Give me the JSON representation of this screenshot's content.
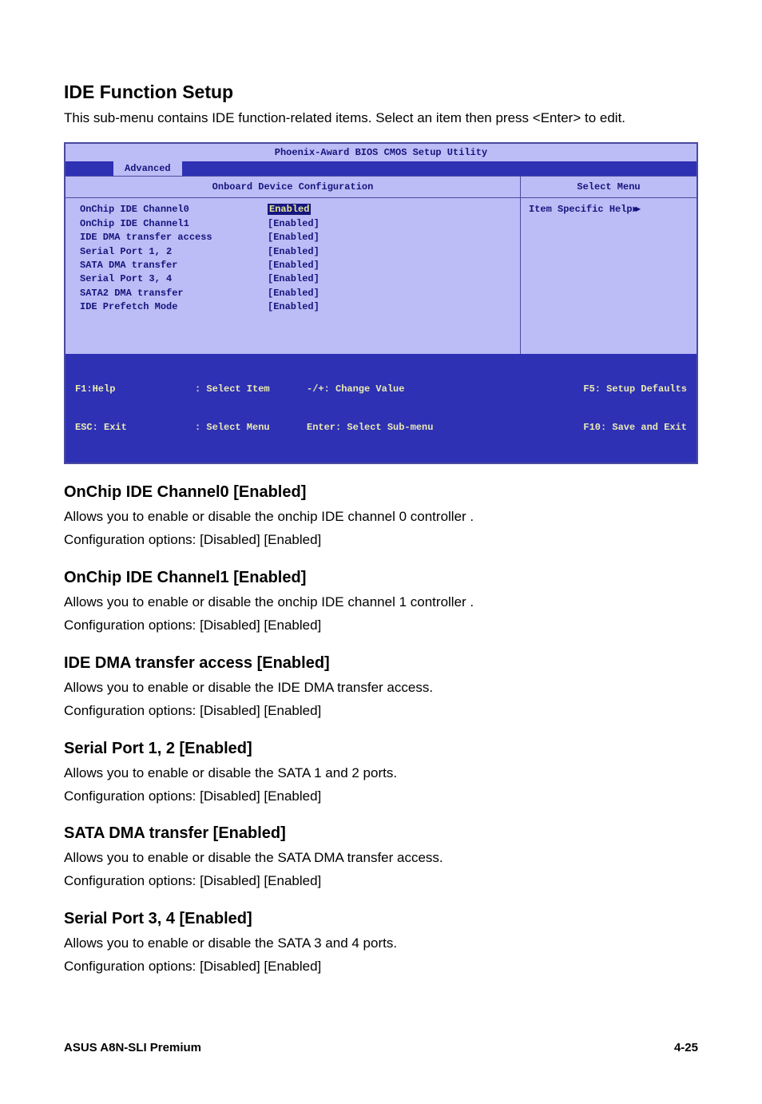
{
  "intro": {
    "heading": "IDE Function Setup",
    "text": "This sub-menu contains IDE function-related items. Select an item then press <Enter> to edit."
  },
  "bios": {
    "title": "Phoenix-Award BIOS CMOS Setup Utility",
    "tab": "Advanced",
    "panel_title": "Onboard Device Configuration",
    "select_menu": "Select Menu",
    "help_label": "Item Specific Help",
    "items": [
      {
        "label": "OnChip IDE Channel0",
        "value": "Enabled"
      },
      {
        "label": "OnChip IDE Channel1",
        "value": "[Enabled]"
      },
      {
        "label": "IDE DMA transfer access",
        "value": "[Enabled]"
      },
      {
        "label": "Serial Port 1, 2",
        "value": "[Enabled]"
      },
      {
        "label": "SATA DMA transfer",
        "value": "[Enabled]"
      },
      {
        "label": "Serial Port 3, 4",
        "value": "[Enabled]"
      },
      {
        "label": "SATA2 DMA transfer",
        "value": "[Enabled]"
      },
      {
        "label": "IDE Prefetch Mode",
        "value": "[Enabled]"
      }
    ],
    "footer": {
      "f1": "F1:Help",
      "esc": "ESC: Exit",
      "sel_item": ": Select Item",
      "sel_menu": ": Select Menu",
      "change": "-/+: Change Value",
      "enter": "Enter: Select Sub-menu",
      "f5": "F5: Setup Defaults",
      "f10": "F10: Save and Exit"
    }
  },
  "sections": [
    {
      "heading": "OnChip IDE Channel0 [Enabled]",
      "p1": "Allows you to enable or disable the onchip IDE channel 0 controller .",
      "p2": "Configuration options: [Disabled] [Enabled]"
    },
    {
      "heading": "OnChip IDE Channel1 [Enabled]",
      "p1": "Allows you to enable or disable the onchip IDE channel 1 controller .",
      "p2": "Configuration options: [Disabled] [Enabled]"
    },
    {
      "heading": "IDE DMA transfer access [Enabled]",
      "p1": "Allows you to enable or disable the IDE DMA transfer access.",
      "p2": "Configuration options: [Disabled] [Enabled]"
    },
    {
      "heading": "Serial Port 1, 2 [Enabled]",
      "p1": "Allows you to enable or disable the SATA 1 and 2 ports.",
      "p2": "Configuration options: [Disabled] [Enabled]"
    },
    {
      "heading": "SATA DMA transfer [Enabled]",
      "p1": "Allows you to enable or disable the SATA DMA transfer access.",
      "p2": "Configuration options: [Disabled] [Enabled]"
    },
    {
      "heading": "Serial Port 3, 4 [Enabled]",
      "p1": "Allows you to enable or disable the SATA 3 and 4 ports.",
      "p2": "Configuration options: [Disabled] [Enabled]"
    }
  ],
  "footer": {
    "product": "ASUS A8N-SLI Premium",
    "page": "4-25"
  }
}
